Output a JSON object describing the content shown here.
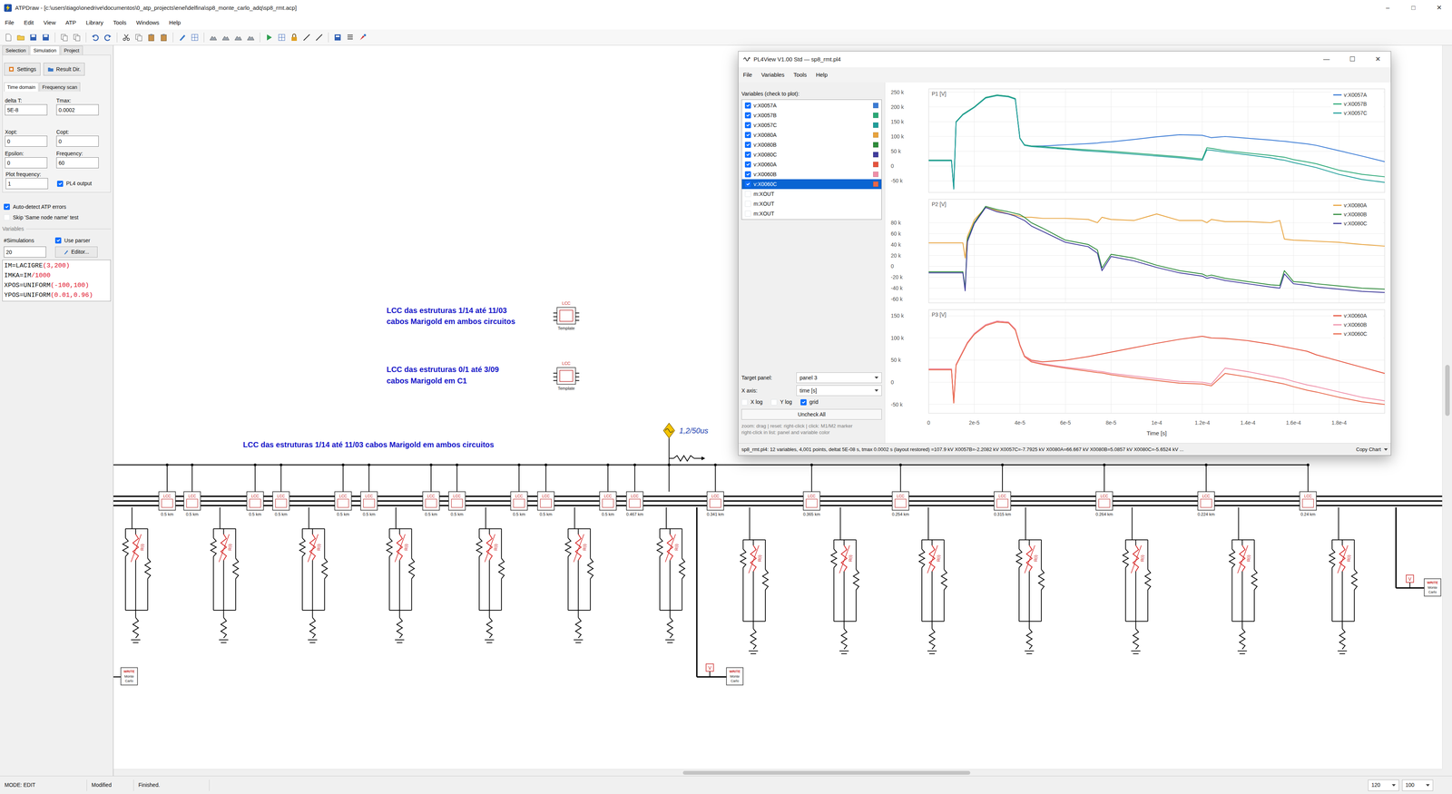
{
  "atpdraw": {
    "title": "ATPDraw - [c:\\users\\tiago\\onedrive\\documentos\\0_atp_projects\\enel\\delfina\\sp8_monte_carlo_adq\\sp8_rmt.acp]",
    "window_controls": [
      "–",
      "□",
      "✕"
    ],
    "menu": [
      "File",
      "Edit",
      "View",
      "ATP",
      "Library",
      "Tools",
      "Windows",
      "Help"
    ],
    "side_tabs": [
      {
        "label": "Selection",
        "selected": false
      },
      {
        "label": "Simulation",
        "selected": true
      },
      {
        "label": "Project",
        "selected": false
      }
    ],
    "side_buttons": [
      "Settings",
      "Result Dir."
    ],
    "sim_tabs": [
      {
        "label": "Time domain",
        "selected": true
      },
      {
        "label": "Frequency scan",
        "selected": false
      }
    ],
    "fields": [
      {
        "label": "delta T:",
        "value": "5E-8"
      },
      {
        "label": "Tmax:",
        "value": "0.0002"
      },
      {
        "label": "Xopt:",
        "value": "0"
      },
      {
        "label": "Copt:",
        "value": "0"
      },
      {
        "label": "Epsilon:",
        "value": "0"
      },
      {
        "label": "Frequency:",
        "value": "60"
      }
    ],
    "plot_frequency": {
      "label": "Plot frequency:",
      "value": "1"
    },
    "pl4_output": {
      "label": "PL4 output",
      "checked": true
    },
    "options": [
      {
        "label": "Auto-detect ATP errors",
        "checked": true
      },
      {
        "label": "Skip 'Same node name' test",
        "checked": false
      }
    ],
    "variables": {
      "legend": "Variables",
      "sims_label": "#Simulations",
      "sims_value": "20",
      "use_parser": {
        "label": "Use parser",
        "checked": true
      },
      "editor_button": "Editor...",
      "code": [
        [
          {
            "text": "IM=LACIGRE",
            "kind": "plain"
          },
          {
            "text": "(3,200)",
            "kind": "literal"
          }
        ],
        [
          {
            "text": "IMKA=IM",
            "kind": "plain"
          },
          {
            "text": "/1000",
            "kind": "literal"
          }
        ],
        [
          {
            "text": "XPOS=UNIFORM",
            "kind": "plain"
          },
          {
            "text": "(-100,100)",
            "kind": "literal"
          }
        ],
        [
          {
            "text": "YPOS=UNIFORM",
            "kind": "plain"
          },
          {
            "text": "(0.01,0.96)",
            "kind": "literal"
          }
        ]
      ]
    },
    "status": {
      "mode": "MODE: EDIT",
      "modified": "Modified",
      "state": "Finished.",
      "zoom": "120",
      "zoom2": "100"
    }
  },
  "diagram": {
    "notes": [
      {
        "lines": [
          "LCC das estruturas 1/14 até 11/03",
          "cabos Marigold em ambos circuitos"
        ]
      },
      {
        "lines": [
          "LCC das estruturas 0/1 até 3/09",
          "cabos Marigold em C1"
        ]
      },
      {
        "lines": [
          "LCC das estruturas 1/14 até 11/03 cabos Marigold em ambos circuitos"
        ]
      }
    ],
    "templates": [
      {
        "tag": "LCC",
        "caption": "Template"
      },
      {
        "tag": "LCC",
        "caption": "Template"
      }
    ],
    "source": {
      "label": "1,2/50us"
    },
    "lines": [
      {
        "tag": "LCC",
        "length": "0.5 km"
      },
      {
        "tag": "LCC",
        "length": "0.5 km"
      },
      {
        "tag": "LCC",
        "length": "0.5 km"
      },
      {
        "tag": "LCC",
        "length": "0.5 km"
      },
      {
        "tag": "LCC",
        "length": "0.5 km"
      },
      {
        "tag": "LCC",
        "length": "0.5 km"
      },
      {
        "tag": "LCC",
        "length": "0.5 km"
      },
      {
        "tag": "LCC",
        "length": "0.5 km"
      },
      {
        "tag": "LCC",
        "length": "0.5 km"
      },
      {
        "tag": "LCC",
        "length": "0.5 km"
      },
      {
        "tag": "LCC",
        "length": "0.5 km"
      },
      {
        "tag": "LCC",
        "length": "0.467 km"
      },
      {
        "tag": "LCC",
        "length": "0.341 km"
      },
      {
        "tag": "LCC",
        "length": "0.365 km"
      },
      {
        "tag": "LCC",
        "length": "0.254 km"
      },
      {
        "tag": "LCC",
        "length": "0.315 km"
      },
      {
        "tag": "LCC",
        "length": "0.264 km"
      },
      {
        "tag": "LCC",
        "length": "0.224 km"
      },
      {
        "tag": "LCC",
        "length": "0.24 km"
      }
    ],
    "towers": [
      {
        "label": "R(i)"
      },
      {
        "label": "R(i)"
      },
      {
        "label": "R(i)"
      },
      {
        "label": "R(i)"
      },
      {
        "label": "R(i)"
      },
      {
        "label": "R(i)"
      },
      {
        "label": "R(i)"
      },
      {
        "label": "R(i)"
      },
      {
        "label": "R(i)"
      },
      {
        "label": "R(i)"
      },
      {
        "label": "R(i)"
      },
      {
        "label": "R(i)"
      },
      {
        "label": "R(i)"
      },
      {
        "label": "R(i)"
      }
    ],
    "probes": [
      {
        "label": "V"
      },
      {
        "label": "V"
      }
    ],
    "writers": [
      {
        "tag": "WRITE",
        "lines": [
          "Monte",
          "Carlo"
        ]
      },
      {
        "tag": "WRITE",
        "lines": [
          "Monte",
          "Carlo"
        ]
      },
      {
        "tag": "WRITE",
        "lines": [
          "Monte",
          "Carlo"
        ]
      }
    ]
  },
  "pl4view": {
    "title": "PL4View V1.00 Std — sp8_rmt.pl4",
    "window_controls": [
      "—",
      "☐",
      "✕"
    ],
    "menu": [
      "File",
      "Variables",
      "Tools",
      "Help"
    ],
    "list_label": "Variables (check to plot):",
    "variables": [
      {
        "name": "v:X0057A",
        "checked": true,
        "selected": false,
        "color": "#3a7bd5"
      },
      {
        "name": "v:X0057B",
        "checked": true,
        "selected": false,
        "color": "#2aa876"
      },
      {
        "name": "v:X0057C",
        "checked": true,
        "selected": false,
        "color": "#1f9e9a"
      },
      {
        "name": "v:X0080A",
        "checked": true,
        "selected": false,
        "color": "#e8a33d"
      },
      {
        "name": "v:X0080B",
        "checked": true,
        "selected": false,
        "color": "#2e8b3a"
      },
      {
        "name": "v:X0080C",
        "checked": true,
        "selected": false,
        "color": "#403c9c"
      },
      {
        "name": "v:X0060A",
        "checked": true,
        "selected": false,
        "color": "#e5533d"
      },
      {
        "name": "v:X0060B",
        "checked": true,
        "selected": false,
        "color": "#ef8fa8"
      },
      {
        "name": "v:X0060C",
        "checked": true,
        "selected": true,
        "color": "#e8674a"
      },
      {
        "name": "m:XOUT",
        "checked": false,
        "selected": false
      },
      {
        "name": "m:XOUT",
        "checked": false,
        "selected": false
      },
      {
        "name": "m:XOUT",
        "checked": false,
        "selected": false
      }
    ],
    "target_panel": {
      "label": "Target panel:",
      "value": "panel 3"
    },
    "x_axis": {
      "label": "X axis:",
      "value": "time [s]"
    },
    "toggles": [
      {
        "label": "X log",
        "checked": false
      },
      {
        "label": "Y log",
        "checked": false
      },
      {
        "label": "grid",
        "checked": true
      }
    ],
    "uncheck_all": "Uncheck All",
    "help": [
      "zoom: drag | reset: right-click | click: M1/M2 marker",
      "right-click in list: panel and variable color"
    ],
    "chart": {
      "time_us": [
        0,
        10,
        11,
        12,
        15,
        16,
        17,
        20,
        25,
        30,
        35,
        38,
        40,
        42,
        45,
        50,
        60,
        70,
        74,
        76,
        80,
        90,
        100,
        110,
        120,
        122,
        124,
        130,
        140,
        150,
        154,
        156,
        160,
        166,
        170,
        180,
        190,
        200
      ],
      "x_ticks": [
        {
          "label": "0",
          "t": 0
        },
        {
          "label": "2e-5",
          "t": 20
        },
        {
          "label": "4e-5",
          "t": 40
        },
        {
          "label": "6e-5",
          "t": 60
        },
        {
          "label": "8e-5",
          "t": 80
        },
        {
          "label": "1e-4",
          "t": 100
        },
        {
          "label": "1.2e-4",
          "t": 120
        },
        {
          "label": "1.4e-4",
          "t": 140
        },
        {
          "label": "1.6e-4",
          "t": 160
        },
        {
          "label": "1.8e-4",
          "t": 180
        }
      ],
      "x_title": "Time [s]",
      "panels": [
        {
          "title": "P1 [V]",
          "y_ticks": [
            {
              "label": "250 k",
              "value": 250
            },
            {
              "label": "200 k",
              "value": 200
            },
            {
              "label": "150 k",
              "value": 150
            },
            {
              "label": "100 k",
              "value": 100
            },
            {
              "label": "50 k",
              "value": 50
            },
            {
              "label": "0",
              "value": 0
            },
            {
              "label": "-50 k",
              "value": -50
            }
          ],
          "series": [
            {
              "name": "v:X0057A",
              "color": "#3a7bd5",
              "values_kV": [
                20,
                20,
                -75,
                150,
                175,
                180,
                185,
                200,
                232,
                240,
                236,
                228,
                95,
                72,
                68,
                68,
                72,
                76,
                78,
                80,
                82,
                90,
                99,
                106,
                104,
                100,
                96,
                100,
                94,
                88,
                85,
                84,
                80,
                75,
                70,
                52,
                34,
                15
              ]
            },
            {
              "name": "v:X0057B",
              "color": "#2aa876",
              "values_kV": [
                20,
                20,
                -75,
                150,
                175,
                180,
                185,
                200,
                232,
                240,
                236,
                228,
                95,
                72,
                68,
                66,
                60,
                55,
                53,
                52,
                50,
                44,
                38,
                32,
                24,
                62,
                60,
                52,
                44,
                36,
                32,
                30,
                22,
                14,
                8,
                -14,
                -28,
                -36
              ]
            },
            {
              "name": "v:X0057C",
              "color": "#1f9e9a",
              "values_kV": [
                18,
                18,
                -78,
                148,
                173,
                178,
                183,
                198,
                230,
                238,
                234,
                226,
                93,
                70,
                66,
                63,
                57,
                51,
                49,
                48,
                46,
                40,
                34,
                28,
                20,
                55,
                54,
                47,
                38,
                28,
                22,
                20,
                12,
                2,
                -5,
                -28,
                -45,
                -55
              ]
            }
          ]
        },
        {
          "title": "P2 [V]",
          "y_ticks": [
            {
              "label": "80 k",
              "value": 80
            },
            {
              "label": "60 k",
              "value": 60
            },
            {
              "label": "40 k",
              "value": 40
            },
            {
              "label": "20 k",
              "value": 20
            },
            {
              "label": "0",
              "value": 0
            },
            {
              "label": "-20 k",
              "value": -20
            },
            {
              "label": "-40 k",
              "value": -40
            },
            {
              "label": "-60 k",
              "value": -60
            }
          ],
          "series": [
            {
              "name": "v:X0080A",
              "color": "#e8a33d",
              "values_kV": [
                43,
                43,
                43,
                43,
                43,
                15,
                55,
                85,
                108,
                102,
                96,
                94,
                92,
                90,
                90,
                88,
                88,
                86,
                80,
                90,
                86,
                84,
                96,
                84,
                84,
                80,
                86,
                82,
                82,
                80,
                84,
                50,
                48,
                47,
                46,
                44,
                40,
                37
              ]
            },
            {
              "name": "v:X0080B",
              "color": "#2e8b3a",
              "values_kV": [
                -10,
                -10,
                -10,
                -10,
                -10,
                -40,
                50,
                80,
                110,
                104,
                100,
                97,
                95,
                90,
                80,
                70,
                48,
                40,
                30,
                -3,
                22,
                15,
                2,
                -8,
                -14,
                -18,
                -16,
                -22,
                -28,
                -34,
                -35,
                -8,
                -28,
                -30,
                -32,
                -36,
                -40,
                -42
              ]
            },
            {
              "name": "v:X0080C",
              "color": "#403c9c",
              "values_kV": [
                -12,
                -12,
                -12,
                -12,
                -12,
                -45,
                45,
                78,
                108,
                100,
                96,
                92,
                88,
                84,
                74,
                64,
                44,
                36,
                24,
                -8,
                18,
                10,
                -2,
                -12,
                -18,
                -22,
                -20,
                -26,
                -32,
                -38,
                -40,
                -14,
                -32,
                -35,
                -38,
                -42,
                -46,
                -48
              ]
            }
          ]
        },
        {
          "title": "P3 [V]",
          "y_ticks": [
            {
              "label": "150 k",
              "value": 150
            },
            {
              "label": "100 k",
              "value": 100
            },
            {
              "label": "50 k",
              "value": 50
            },
            {
              "label": "0",
              "value": 0
            },
            {
              "label": "-50 k",
              "value": -50
            }
          ],
          "series": [
            {
              "name": "v:X0060A",
              "color": "#e5533d",
              "values_kV": [
                30,
                30,
                -45,
                40,
                70,
                80,
                90,
                110,
                130,
                138,
                136,
                120,
                85,
                60,
                50,
                46,
                50,
                58,
                62,
                64,
                68,
                78,
                88,
                97,
                104,
                102,
                100,
                99,
                94,
                86,
                82,
                80,
                76,
                70,
                62,
                48,
                34,
                20
              ]
            },
            {
              "name": "v:X0060B",
              "color": "#ef8fa8",
              "values_kV": [
                30,
                30,
                -45,
                40,
                70,
                80,
                90,
                110,
                130,
                138,
                136,
                120,
                85,
                60,
                48,
                42,
                34,
                28,
                25,
                24,
                20,
                14,
                8,
                2,
                0,
                -2,
                -4,
                32,
                24,
                14,
                10,
                8,
                2,
                -6,
                -10,
                -22,
                -34,
                -42
              ]
            },
            {
              "name": "v:X0060C",
              "color": "#e8674a",
              "values_kV": [
                28,
                28,
                -47,
                38,
                68,
                78,
                88,
                108,
                128,
                136,
                134,
                118,
                83,
                58,
                46,
                40,
                32,
                25,
                22,
                21,
                17,
                10,
                4,
                -2,
                -4,
                -6,
                -8,
                20,
                12,
                2,
                -2,
                -4,
                -10,
                -18,
                -22,
                -34,
                -44,
                -50
              ]
            }
          ]
        }
      ]
    },
    "status": "sp8_rmt.pl4: 12 variables, 4,001 points, deltat 5E-08 s, tmax 0.0002 s (layout restored) =107.9 kV X0057B=-2.2082 kV X0057C=-7.7925 kV X0080A=66.667 kV X0080B=5.0857 kV X0080C=-5.6524 kV ...",
    "copy_chart": "Copy Chart"
  }
}
